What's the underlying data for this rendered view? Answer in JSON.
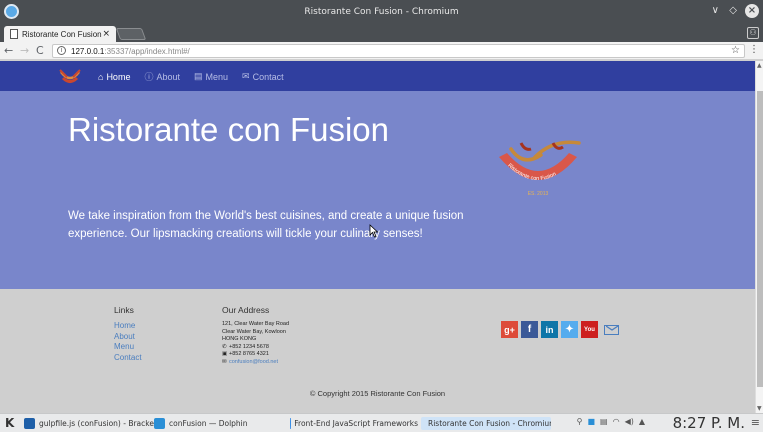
{
  "window": {
    "title": "Ristorante Con Fusion - Chromium"
  },
  "tab": {
    "label": "Ristorante Con Fusion",
    "close": "×"
  },
  "address_bar": {
    "host": "127.0.0.1",
    "path": ":35337/app/index.html#/"
  },
  "navbar": {
    "items": [
      {
        "label": "Home",
        "icon": "home-icon",
        "active": true
      },
      {
        "label": "About",
        "icon": "info-icon",
        "active": false
      },
      {
        "label": "Menu",
        "icon": "list-icon",
        "active": false
      },
      {
        "label": "Contact",
        "icon": "envelope-icon",
        "active": false
      }
    ]
  },
  "jumbotron": {
    "heading": "Ristorante con Fusion",
    "text": "We take inspiration from the World's best cuisines, and create a unique fusion experience. Our lipsmacking creations will tickle your culinary senses!",
    "logo_text": "Ristorante con Fusion",
    "logo_est": "ES. 2013"
  },
  "footer": {
    "links_heading": "Links",
    "links": [
      "Home",
      "About",
      "Menu",
      "Contact"
    ],
    "address_heading": "Our Address",
    "address_lines": [
      "121, Clear Water Bay Road",
      "Clear Water Bay, Kowloon",
      "HONG KONG"
    ],
    "phone": "+852 1234 5678",
    "fax": "+852 8765 4321",
    "email": "confusion@food.net",
    "social": [
      "google-plus-icon",
      "facebook-icon",
      "linkedin-icon",
      "twitter-icon",
      "youtube-icon",
      "mail-icon"
    ],
    "copyright": "© Copyright 2015 Ristorante Con Fusion"
  },
  "taskbar": {
    "tasks": [
      {
        "label": "gulpfile.js (conFusion) - Brackets",
        "color": "#1e5fa8"
      },
      {
        "label": "conFusion — Dolphin",
        "color": "#2a8fd6"
      },
      {
        "label": "Front-End JavaScript Frameworks",
        "color": "#3a8ee6"
      },
      {
        "label": "Ristorante Con Fusion - Chromium",
        "color": "#3a8ee6"
      }
    ],
    "clock": "8:27 P. M."
  },
  "colors": {
    "navbar": "#303f9f",
    "jumbotron": "#7986cb",
    "footer": "#cfcfcf",
    "link": "#4a7ebf"
  }
}
